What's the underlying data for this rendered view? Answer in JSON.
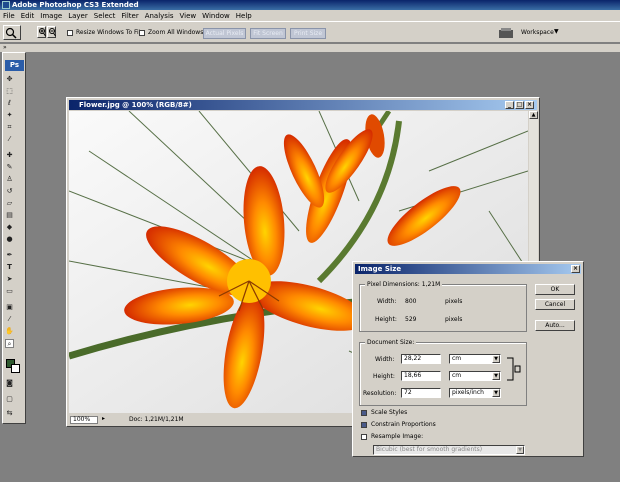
{
  "app": {
    "title": "Adobe Photoshop CS3 Extended"
  },
  "menu": [
    "File",
    "Edit",
    "Image",
    "Layer",
    "Select",
    "Filter",
    "Analysis",
    "View",
    "Window",
    "Help"
  ],
  "options_bar": {
    "resize_windows_label": "Resize Windows To Fit",
    "zoom_all_windows_label": "Zoom All Windows",
    "actual_pixels_label": "Actual Pixels",
    "fit_screen_label": "Fit Screen",
    "print_size_label": "Print Size",
    "workspace_label": "Workspace"
  },
  "toolbox": {
    "logo": "Ps"
  },
  "document": {
    "title": "Flower.jpg @ 100% (RGB/8#)",
    "zoom": "100%",
    "doc_size": "Doc: 1,21M/1,21M",
    "foreground_color": "#2f5a2f"
  },
  "dialog": {
    "title": "Image Size",
    "pixel_dimensions_label": "Pixel Dimensions:",
    "pixel_dimensions_value": "1,21M",
    "width_label": "Width:",
    "width_value": "800",
    "width_unit": "pixels",
    "height_label": "Height:",
    "height_value": "529",
    "height_unit": "pixels",
    "document_size_label": "Document Size:",
    "doc_width_label": "Width:",
    "doc_width_value": "28,22",
    "doc_width_unit": "cm",
    "doc_height_label": "Height:",
    "doc_height_value": "18,66",
    "doc_height_unit": "cm",
    "resolution_label": "Resolution:",
    "resolution_value": "72",
    "resolution_unit": "pixels/inch",
    "scale_styles_label": "Scale Styles",
    "scale_styles_checked": true,
    "constrain_label": "Constrain Proportions",
    "constrain_checked": true,
    "resample_label": "Resample Image:",
    "resample_checked": false,
    "resample_method": "Bicubic (best for smooth gradients)",
    "ok_label": "OK",
    "cancel_label": "Cancel",
    "auto_label": "Auto..."
  }
}
